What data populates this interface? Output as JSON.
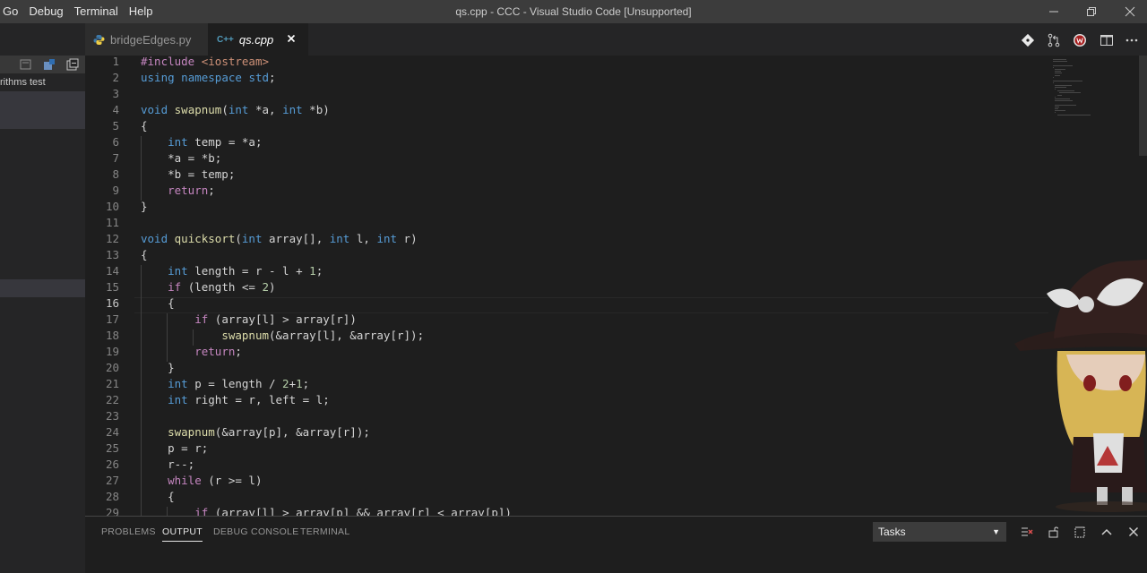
{
  "window": {
    "title": "qs.cpp - CCC - Visual Studio Code [Unsupported]",
    "menu": [
      "Go",
      "Debug",
      "Terminal",
      "Help"
    ]
  },
  "sidebar": {
    "folder_label": "rithms test"
  },
  "tabs": [
    {
      "label": "bridgeEdges.py",
      "icon": "python-icon",
      "active": false
    },
    {
      "label": "qs.cpp",
      "icon": "cpp-icon",
      "active": true
    }
  ],
  "tab_cpp_glyph": "C++",
  "editor": {
    "active_line": 16,
    "lines": [
      "#include <iostream>",
      "using namespace std;",
      "",
      "void swapnum(int *a, int *b)",
      "{",
      "    int temp = *a;",
      "    *a = *b;",
      "    *b = temp;",
      "    return;",
      "}",
      "",
      "void quicksort(int array[], int l, int r)",
      "{",
      "    int length = r - l + 1;",
      "    if (length <= 2)",
      "    {",
      "        if (array[l] > array[r])",
      "            swapnum(&array[l], &array[r]);",
      "        return;",
      "    }",
      "    int p = length / 2+1;",
      "    int right = r, left = l;",
      "",
      "    swapnum(&array[p], &array[r]);",
      "    p = r;",
      "    r--;",
      "    while (r >= l)",
      "    {",
      "        if (array[l] > array[p] && array[r] < array[p])"
    ]
  },
  "panel": {
    "tabs": [
      "PROBLEMS",
      "OUTPUT",
      "DEBUG CONSOLE",
      "TERMINAL"
    ],
    "active_tab": "OUTPUT",
    "task_select": "Tasks"
  },
  "colors": {
    "keyword": "#569cd6",
    "control": "#c586c0",
    "function": "#dcdcaa",
    "background": "#1e1e1e"
  }
}
